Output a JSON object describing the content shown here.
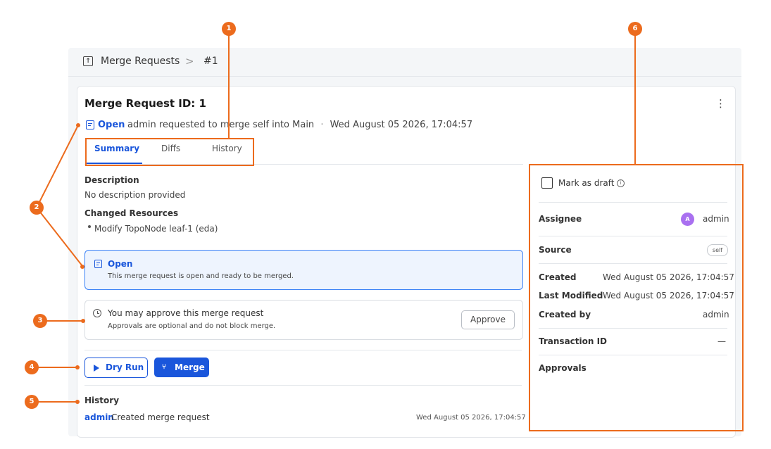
{
  "breadcrumb": {
    "icon": "merge-requests-icon",
    "section": "Merge Requests",
    "separator": ">",
    "current": "#1"
  },
  "header": {
    "title": "Merge Request ID: 1",
    "status": "Open",
    "summary": "admin requested to merge self into Main",
    "dot": "·",
    "timestamp": "Wed August 05 2026, 17:04:57",
    "menu_icon": "kebab-menu-icon",
    "menu_glyph": "⋮"
  },
  "tabs": [
    {
      "label": "Summary",
      "active": true
    },
    {
      "label": "Diffs",
      "active": false
    },
    {
      "label": "History",
      "active": false
    }
  ],
  "summary": {
    "description_label": "Description",
    "description_value": "No description provided",
    "changed_label": "Changed Resources",
    "changed_items": [
      "Modify TopoNode leaf-1 (eda)"
    ]
  },
  "status_box": {
    "title": "Open",
    "text": "This merge request is open and ready to be merged."
  },
  "approval_box": {
    "title": "You may approve this merge request",
    "text": "Approvals are optional and do not block merge.",
    "button": "Approve"
  },
  "actions": {
    "dry_run": "Dry Run",
    "merge": "Merge",
    "merge_glyph": "⑂"
  },
  "history": {
    "title": "History",
    "entries": [
      {
        "user": "admin",
        "action": "Created merge request",
        "time": "Wed August 05 2026, 17:04:57"
      }
    ]
  },
  "sidebar": {
    "draft_label": "Mark as draft",
    "info_glyph": "i",
    "assignee_label": "Assignee",
    "assignee_initial": "A",
    "assignee_name": "admin",
    "source_label": "Source",
    "source_value": "self",
    "created_label": "Created",
    "created_value": "Wed August 05 2026, 17:04:57",
    "modified_label": "Last Modified",
    "modified_value": "Wed August 05 2026, 17:04:57",
    "created_by_label": "Created by",
    "created_by_value": "admin",
    "transaction_label": "Transaction ID",
    "transaction_value": "—",
    "approvals_label": "Approvals"
  },
  "annotations": [
    "1",
    "2",
    "3",
    "4",
    "5",
    "6"
  ],
  "colors": {
    "accent": "#1a56db",
    "annotation": "#ec6b1d",
    "avatar": "#a970f0"
  }
}
